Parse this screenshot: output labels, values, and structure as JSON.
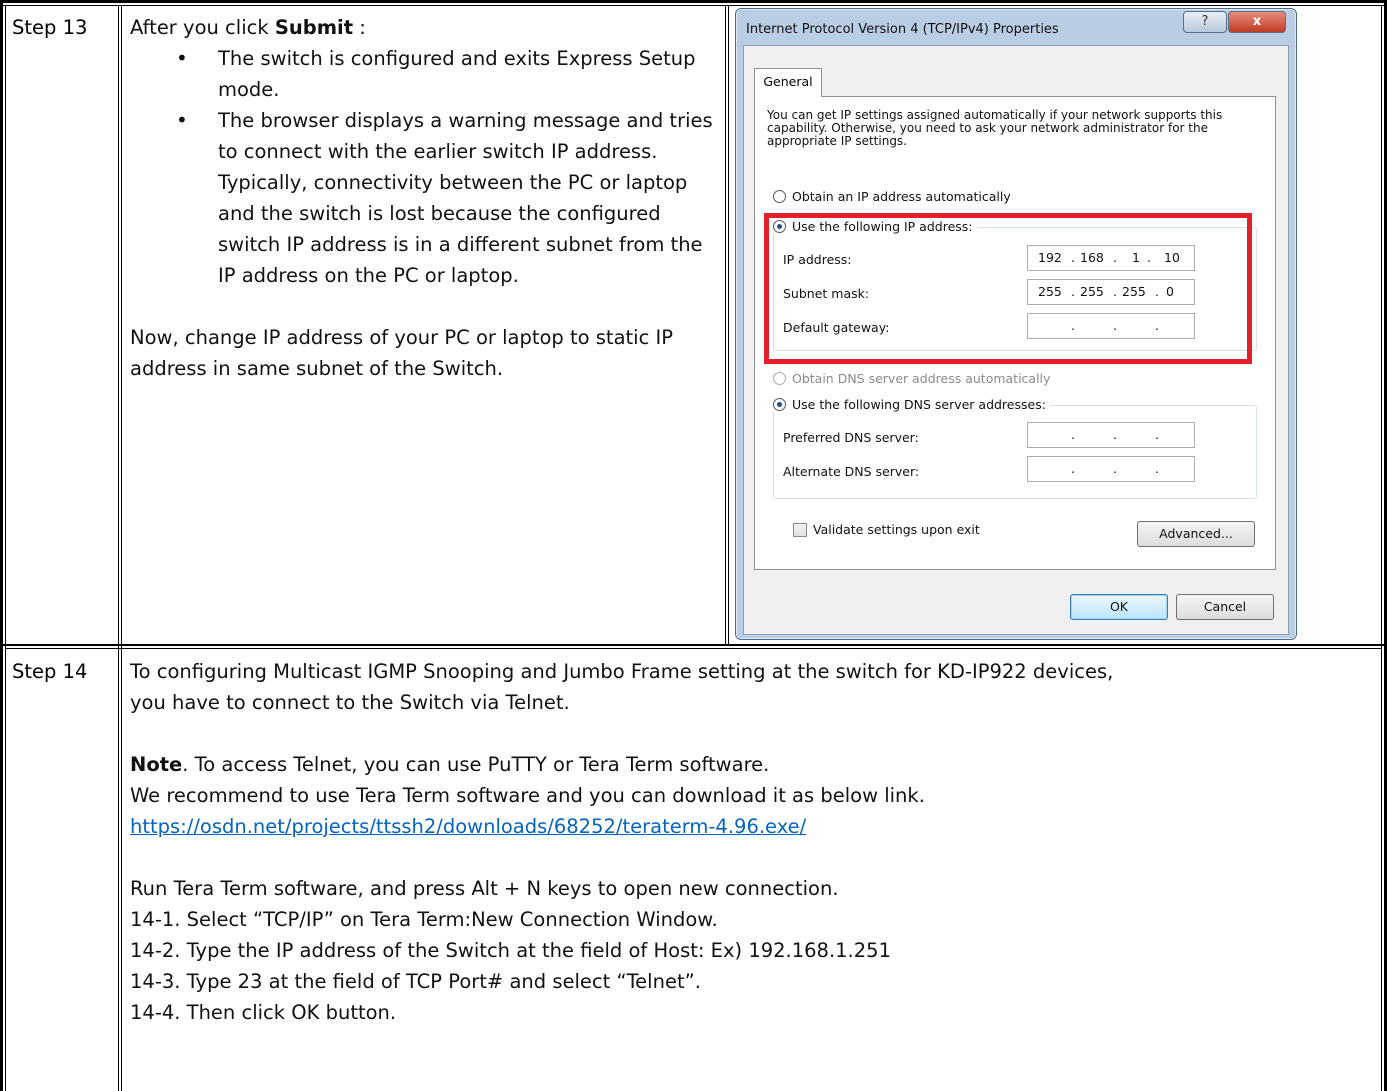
{
  "step13": {
    "label": "Step 13",
    "intro_prefix": "After you click ",
    "intro_bold": "Submit",
    "intro_suffix": " :",
    "bullet1": "The switch is configured and exits Express Setup mode.",
    "bullet2": "The browser displays a warning message and tries to connect with the earlier switch IP address. Typically, connectivity between the PC or laptop and the switch is lost because the configured switch IP address is in a different subnet from the IP address on the PC or laptop.",
    "note": "Now, change IP address of your PC or laptop to static IP address in same subnet of the Switch."
  },
  "dialog": {
    "title": "Internet Protocol Version 4 (TCP/IPv4) Properties",
    "help_label": "?",
    "close_label": "x",
    "tab_general": "General",
    "intro": "You can get IP settings assigned automatically if your network supports this capability. Otherwise, you need to ask your network administrator for the appropriate IP settings.",
    "obtain_ip_auto": "Obtain an IP address automatically",
    "use_following_ip": "Use the following IP address:",
    "ip_address_label": "IP address:",
    "ip_address": [
      "192",
      "168",
      "1",
      "10"
    ],
    "subnet_mask_label": "Subnet mask:",
    "subnet_mask": [
      "255",
      "255",
      "255",
      "0"
    ],
    "default_gateway_label": "Default gateway:",
    "obtain_dns_auto": "Obtain DNS server address automatically",
    "use_following_dns": "Use the following DNS server addresses:",
    "preferred_dns_label": "Preferred DNS server:",
    "alternate_dns_label": "Alternate DNS server:",
    "validate_label": "Validate settings upon exit",
    "advanced_button": "Advanced...",
    "ok_button": "OK",
    "cancel_button": "Cancel"
  },
  "step14": {
    "label": "Step 14",
    "line1": "To configuring Multicast IGMP Snooping and Jumbo Frame setting at the switch for KD-IP922 devices,",
    "line2": "you have to connect to the Switch via Telnet.",
    "note_bold": "Note",
    "note_rest": ". To access Telnet, you can use PuTTY or Tera Term software.",
    "recommend": "We recommend to use Tera Term software and you can download it as below link.",
    "link": "https://osdn.net/projects/ttssh2/downloads/68252/teraterm-4.96.exe/",
    "run": "Run Tera Term software, and press Alt + N keys to open new connection.",
    "s1": "14-1. Select “TCP/IP” on Tera Term:New Connection Window.",
    "s2": "14-2. Type the IP address of the Switch at the field of Host:   Ex) 192.168.1.251",
    "s3": "14-3. Type 23 at the field of TCP Port# and select “Telnet”.",
    "s4": "14-4. Then click OK button."
  }
}
